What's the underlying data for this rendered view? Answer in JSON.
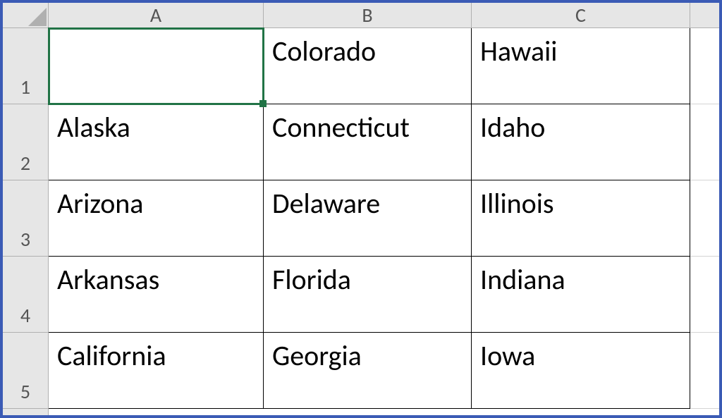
{
  "columns": [
    "A",
    "B",
    "C"
  ],
  "rows": [
    "1",
    "2",
    "3",
    "4",
    "5"
  ],
  "cells": {
    "A1": "",
    "B1": "Colorado",
    "C1": "Hawaii",
    "A2": "Alaska",
    "B2": "Connecticut",
    "C2": "Idaho",
    "A3": "Arizona",
    "B3": "Delaware",
    "C3": "Illinois",
    "A4": "Arkansas",
    "B4": "Florida",
    "C4": "Indiana",
    "A5": "California",
    "B5": "Georgia",
    "C5": "Iowa"
  },
  "selected_cell": "A1"
}
